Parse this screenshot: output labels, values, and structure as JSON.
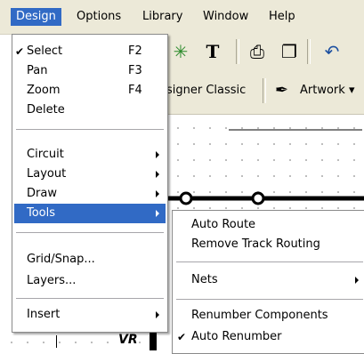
{
  "menubar": {
    "items": [
      "Design",
      "Options",
      "Library",
      "Window",
      "Help"
    ]
  },
  "toolbar": {
    "combo_text": "signer Classic",
    "artwork_label": "Artwork",
    "artwork_arrow": "▾",
    "text_tool_glyph": "T",
    "route_glyph": "✳",
    "print_glyph": "⎙",
    "clipboard_glyph": "❐",
    "undo_glyph": "↶",
    "wand_glyph": "✒"
  },
  "design_menu": {
    "check_glyph": "✔",
    "items": [
      {
        "label": "Select",
        "shortcut": "F2",
        "checked": true
      },
      {
        "label": "Pan",
        "shortcut": "F3"
      },
      {
        "label": "Zoom",
        "shortcut": "F4"
      },
      {
        "label": "Delete"
      },
      {
        "label": "Circuit",
        "submenu": true
      },
      {
        "label": "Layout",
        "submenu": true
      },
      {
        "label": "Draw",
        "submenu": true
      },
      {
        "label": "Tools",
        "submenu": true,
        "highlighted": true
      },
      {
        "label": "Grid/Snap..."
      },
      {
        "label": "Layers..."
      },
      {
        "label": "Insert",
        "submenu": true
      }
    ]
  },
  "tools_submenu": {
    "items": [
      {
        "label": "Auto Route"
      },
      {
        "label": "Remove Track Routing"
      },
      {
        "label": "Nets",
        "submenu": true
      },
      {
        "label": "Renumber Components"
      },
      {
        "label": "Auto Renumber",
        "checked": true
      }
    ]
  },
  "canvas": {
    "label": "VR"
  },
  "colors": {
    "menu_highlight": "#316ac5",
    "menubar_bg": "#ece9d8",
    "trace": "#000000"
  }
}
